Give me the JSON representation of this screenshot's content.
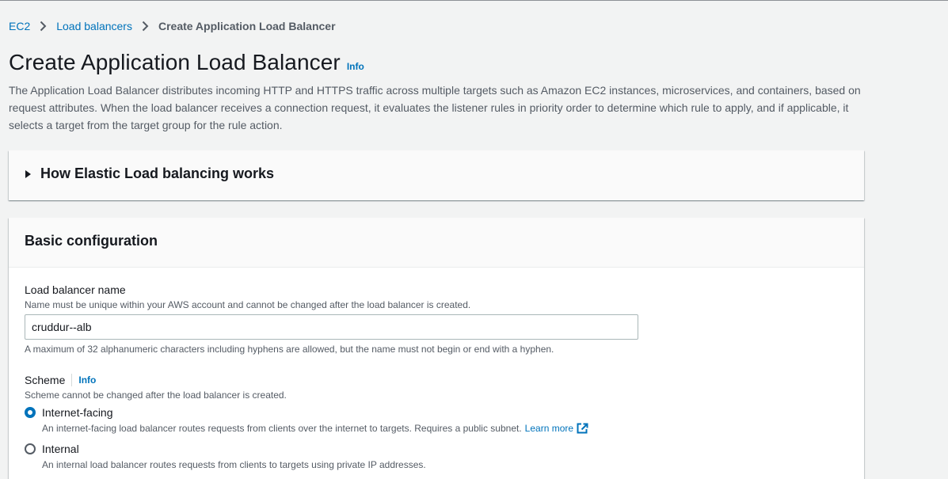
{
  "breadcrumb": {
    "items": [
      "EC2",
      "Load balancers"
    ],
    "current": "Create Application Load Balancer"
  },
  "header": {
    "title": "Create Application Load Balancer",
    "info": "Info",
    "description": "The Application Load Balancer distributes incoming HTTP and HTTPS traffic across multiple targets such as Amazon EC2 instances, microservices, and containers, based on request attributes. When the load balancer receives a connection request, it evaluates the listener rules in priority order to determine which rule to apply, and if applicable, it selects a target from the target group for the rule action."
  },
  "how_it_works": {
    "title": "How Elastic Load balancing works"
  },
  "basic_config": {
    "title": "Basic configuration",
    "name_field": {
      "label": "Load balancer name",
      "description": "Name must be unique within your AWS account and cannot be changed after the load balancer is created.",
      "value": "cruddur--alb",
      "constraint": "A maximum of 32 alphanumeric characters including hyphens are allowed, but the name must not begin or end with a hyphen."
    },
    "scheme": {
      "label": "Scheme",
      "info": "Info",
      "description": "Scheme cannot be changed after the load balancer is created.",
      "options": [
        {
          "label": "Internet-facing",
          "description": "An internet-facing load balancer routes requests from clients over the internet to targets. Requires a public subnet.",
          "link": "Learn more",
          "checked": true
        },
        {
          "label": "Internal",
          "description": "An internal load balancer routes requests from clients to targets using private IP addresses.",
          "checked": false
        }
      ]
    }
  },
  "colors": {
    "link": "#0073bb",
    "background": "#f2f3f3",
    "panel": "#ffffff",
    "text": "#16191f",
    "secondary_text": "#545b64"
  }
}
